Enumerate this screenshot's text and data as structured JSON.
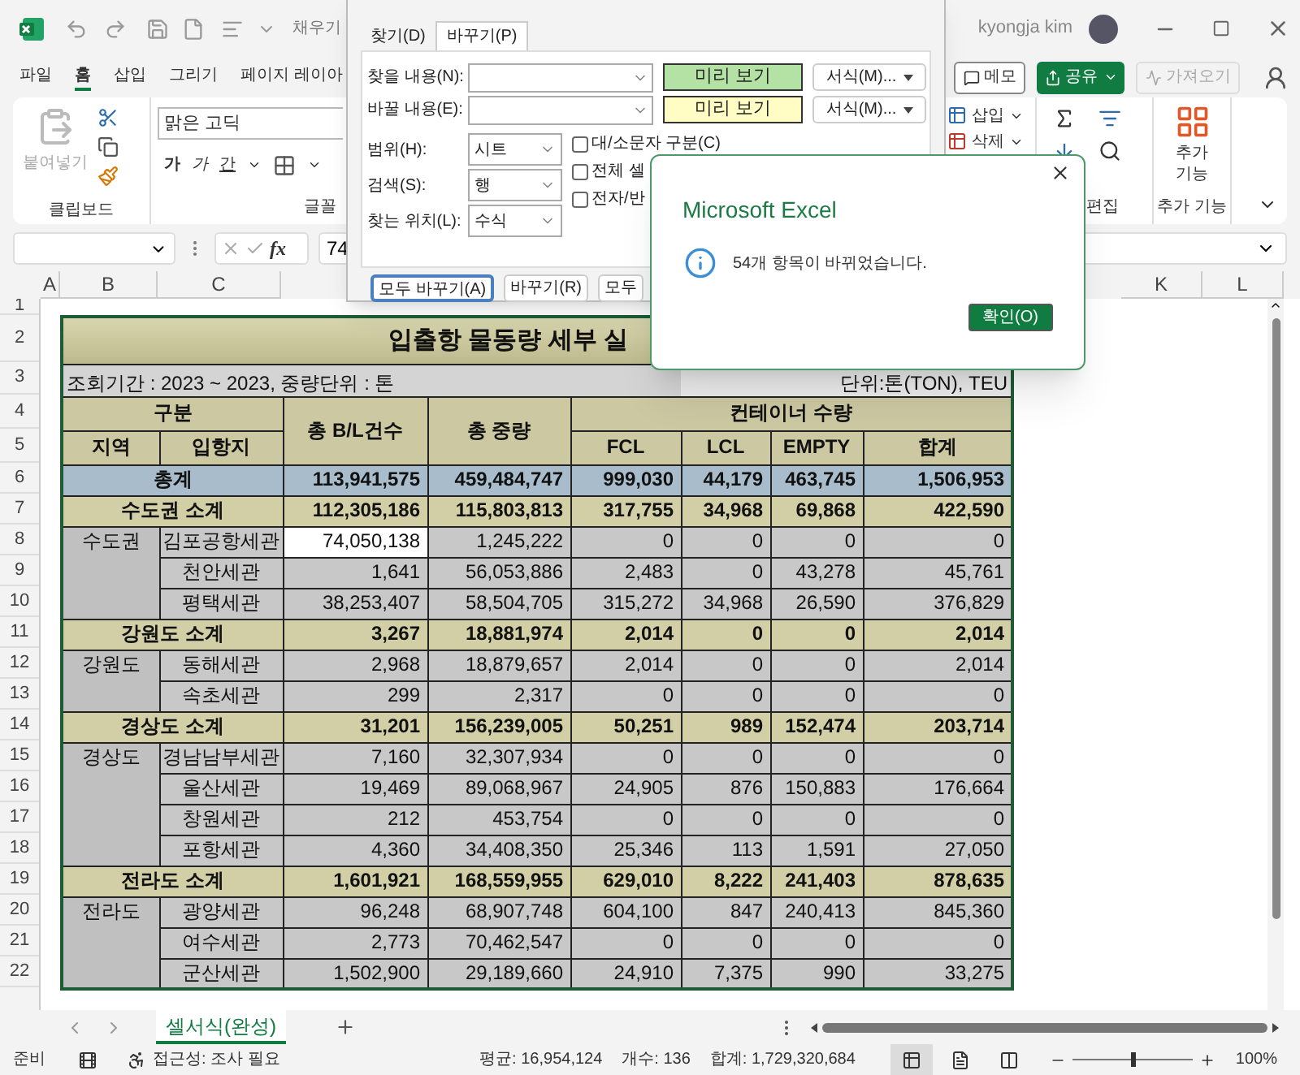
{
  "title_bar": {
    "title": "채우기",
    "user": "kyongja kim"
  },
  "ribbon_tabs": [
    {
      "label": "파일",
      "selected": false
    },
    {
      "label": "홈",
      "selected": true
    },
    {
      "label": "삽입",
      "selected": false
    },
    {
      "label": "그리기",
      "selected": false
    },
    {
      "label": "페이지 레이아",
      "selected": false
    }
  ],
  "top_buttons": [
    {
      "kind": "memo",
      "label": "메모"
    },
    {
      "kind": "share",
      "label": "공유"
    },
    {
      "kind": "get",
      "label": "가져오기",
      "disabled": true
    }
  ],
  "ribbon": {
    "paste": "붙여넣기",
    "clipboard_label": "클립보드",
    "font_name": "맑은 고딕",
    "font_styles": [
      "가",
      "가",
      "간"
    ],
    "font_label": "글꼴",
    "insert": "삽입",
    "delete": "삭제",
    "editing_label": "편집",
    "addins_button": "추가 기능",
    "addins_label": "추가 기능"
  },
  "formula_bar": {
    "fx": "fx",
    "value": "74"
  },
  "column_headers": [
    "A",
    "B",
    "C",
    "K",
    "L"
  ],
  "row_numbers": [
    "1",
    "2",
    "3",
    "4",
    "5",
    "6",
    "7",
    "8",
    "9",
    "10",
    "11",
    "12",
    "13",
    "14",
    "15",
    "16",
    "17",
    "18",
    "19",
    "20",
    "21",
    "22"
  ],
  "sheet": {
    "title": "입출항 물동량 세부 실",
    "period": "조회기간 : 2023 ~ 2023, 중량단위 : 톤",
    "unit": "단위:톤(TON), TEU",
    "header_group": "구분",
    "header_region": "지역",
    "header_port": "입항지",
    "header_bl": "총 B/L건수",
    "header_weight": "총 중량",
    "header_container": "컨테이너 수량",
    "container_columns": [
      "FCL",
      "LCL",
      "EMPTY",
      "합계"
    ],
    "total": {
      "label": "총계",
      "values": [
        "113,941,575",
        "459,484,747",
        "999,030",
        "44,179",
        "463,745",
        "1,506,953"
      ]
    },
    "regions": [
      {
        "subtotal": {
          "label": "수도권 소계",
          "values": [
            "112,305,186",
            "115,803,813",
            "317,755",
            "34,968",
            "69,868",
            "422,590"
          ]
        },
        "name": "수도권",
        "ports": [
          {
            "name": "김포공항세관",
            "selected": true,
            "values": [
              "74,050,138",
              "1,245,222",
              "0",
              "0",
              "0",
              "0"
            ]
          },
          {
            "name": "천안세관",
            "selected": false,
            "values": [
              "1,641",
              "56,053,886",
              "2,483",
              "0",
              "43,278",
              "45,761"
            ]
          },
          {
            "name": "평택세관",
            "selected": false,
            "values": [
              "38,253,407",
              "58,504,705",
              "315,272",
              "34,968",
              "26,590",
              "376,829"
            ]
          }
        ]
      },
      {
        "subtotal": {
          "label": "강원도 소계",
          "values": [
            "3,267",
            "18,881,974",
            "2,014",
            "0",
            "0",
            "2,014"
          ]
        },
        "name": "강원도",
        "ports": [
          {
            "name": "동해세관",
            "selected": false,
            "values": [
              "2,968",
              "18,879,657",
              "2,014",
              "0",
              "0",
              "2,014"
            ]
          },
          {
            "name": "속초세관",
            "selected": false,
            "values": [
              "299",
              "2,317",
              "0",
              "0",
              "0",
              "0"
            ]
          }
        ]
      },
      {
        "subtotal": {
          "label": "경상도 소계",
          "values": [
            "31,201",
            "156,239,005",
            "50,251",
            "989",
            "152,474",
            "203,714"
          ]
        },
        "name": "경상도",
        "ports": [
          {
            "name": "경남남부세관",
            "selected": false,
            "values": [
              "7,160",
              "32,307,934",
              "0",
              "0",
              "0",
              "0"
            ]
          },
          {
            "name": "울산세관",
            "selected": false,
            "values": [
              "19,469",
              "89,068,967",
              "24,905",
              "876",
              "150,883",
              "176,664"
            ]
          },
          {
            "name": "창원세관",
            "selected": false,
            "values": [
              "212",
              "453,754",
              "0",
              "0",
              "0",
              "0"
            ]
          },
          {
            "name": "포항세관",
            "selected": false,
            "values": [
              "4,360",
              "34,408,350",
              "25,346",
              "113",
              "1,591",
              "27,050"
            ]
          }
        ]
      },
      {
        "subtotal": {
          "label": "전라도 소계",
          "values": [
            "1,601,921",
            "168,559,955",
            "629,010",
            "8,222",
            "241,403",
            "878,635"
          ]
        },
        "name": "전라도",
        "ports": [
          {
            "name": "광양세관",
            "selected": false,
            "values": [
              "96,248",
              "68,907,748",
              "604,100",
              "847",
              "240,413",
              "845,360"
            ]
          },
          {
            "name": "여수세관",
            "selected": false,
            "values": [
              "2,773",
              "70,462,547",
              "0",
              "0",
              "0",
              "0"
            ]
          },
          {
            "name": "군산세관",
            "selected": false,
            "values": [
              "1,502,900",
              "29,189,660",
              "24,910",
              "7,375",
              "990",
              "33,275"
            ]
          }
        ]
      }
    ]
  },
  "sheet_tabs": [
    {
      "label": "셀서식(완성)",
      "selected": true
    }
  ],
  "status_bar": {
    "ready": "준비",
    "accessibility": "접근성: 조사 필요",
    "average": "평균: 16,954,124",
    "count": "개수: 136",
    "sum": "합계: 1,729,320,684",
    "views": [
      {
        "kind": "normal",
        "selected": true
      },
      {
        "kind": "page",
        "selected": false
      },
      {
        "kind": "break",
        "selected": false
      }
    ],
    "zoom": {
      "level": 0.5
    },
    "zoom_label": "100%"
  },
  "find_dialog": {
    "tabs": [
      {
        "label": "찾기(D)",
        "selected": false
      },
      {
        "label": "바꾸기(P)",
        "selected": true
      }
    ],
    "fields": [
      {
        "label": "찾을 내용(N):",
        "preview": "미리 보기",
        "color": "#b4e2a4",
        "format": "서식(M)..."
      },
      {
        "label": "바꿀 내용(E):",
        "preview": "미리 보기",
        "color": "#fffdc4",
        "format": "서식(M)..."
      }
    ],
    "options": [
      {
        "label": "범위(H):",
        "value": "시트"
      },
      {
        "label": "검색(S):",
        "value": "행"
      },
      {
        "label": "찾는 위치(L):",
        "value": "수식"
      }
    ],
    "checkboxes": [
      {
        "label": "대/소문자 구분(C)",
        "checked": false
      },
      {
        "label": "전체 셀",
        "checked": false
      },
      {
        "label": "전자/반",
        "checked": false
      }
    ],
    "buttons": [
      {
        "label": "모두 바꾸기(A)",
        "focused": true
      },
      {
        "label": "바꾸기(R)",
        "focused": false
      },
      {
        "label": "모두",
        "focused": false
      }
    ]
  },
  "message_box": {
    "title": "Microsoft Excel",
    "message": "54개 항목이 바뀌었습니다.",
    "button": "확인(O)"
  }
}
